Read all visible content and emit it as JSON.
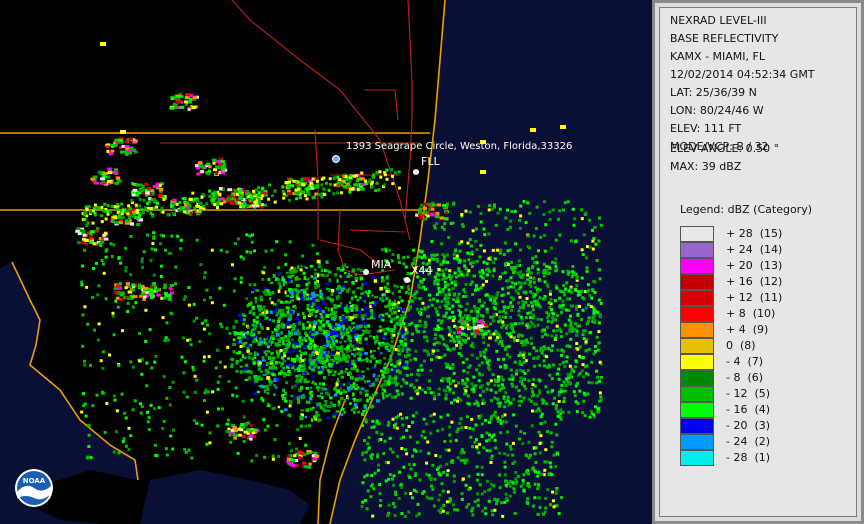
{
  "map": {
    "places": [
      {
        "id": "weston",
        "label": "1393 Seagrape Circle, Weston, Florida,33326"
      },
      {
        "id": "fll",
        "label": "FLL"
      },
      {
        "id": "mia",
        "label": "MIA"
      },
      {
        "id": "x44",
        "label": "X44"
      }
    ],
    "logo_text": "NOAA"
  },
  "info": {
    "product": "NEXRAD LEVEL-III",
    "type": "BASE REFLECTIVITY",
    "station": "KAMX - MIAMI, FL",
    "datetime": "12/02/2014 04:52:34 GMT",
    "lat": "LAT: 25/36/39 N",
    "lon": "LON: 80/24/46 W",
    "elev": "ELEV: 111 FT",
    "mode": "MODE/VCP: B / 32",
    "elev_angle": "ELEV ANGLE: 0.50 °",
    "max": "MAX: 39 dBZ"
  },
  "legend": {
    "title": "Legend: dBZ (Category)",
    "items": [
      {
        "label": "+ 28  (15)",
        "color": "#e8e8e8"
      },
      {
        "label": "+ 24  (14)",
        "color": "#9966cc"
      },
      {
        "label": "+ 20  (13)",
        "color": "#ff00ff"
      },
      {
        "label": "+ 16  (12)",
        "color": "#c00000"
      },
      {
        "label": "+ 12  (11)",
        "color": "#d80000"
      },
      {
        "label": "+ 8  (10)",
        "color": "#ff0000"
      },
      {
        "label": "+ 4  (9)",
        "color": "#ff9000"
      },
      {
        "label": "0  (8)",
        "color": "#e8c000"
      },
      {
        "label": "- 4  (7)",
        "color": "#ffff00"
      },
      {
        "label": "- 8  (6)",
        "color": "#008800"
      },
      {
        "label": "- 12  (5)",
        "color": "#00bb00"
      },
      {
        "label": "- 16  (4)",
        "color": "#00ff00"
      },
      {
        "label": "- 20  (3)",
        "color": "#0000ee"
      },
      {
        "label": "- 24  (2)",
        "color": "#0099ff"
      },
      {
        "label": "- 28  (1)",
        "color": "#00eeee"
      }
    ]
  }
}
